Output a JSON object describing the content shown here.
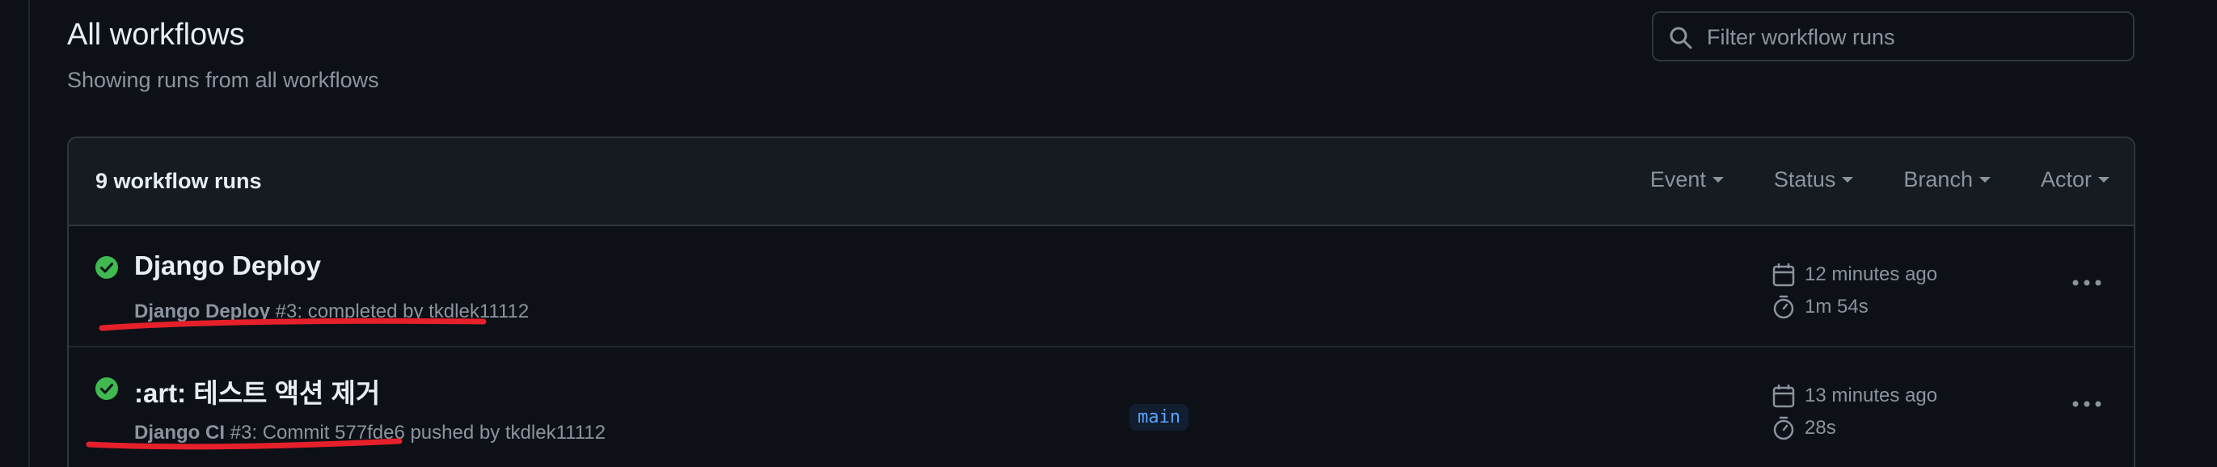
{
  "header": {
    "title": "All workflows",
    "subtitle": "Showing runs from all workflows"
  },
  "search": {
    "placeholder": "Filter workflow runs",
    "icon": "search-icon"
  },
  "runs_box": {
    "count_label": "9 workflow runs",
    "filters": [
      {
        "label": "Event"
      },
      {
        "label": "Status"
      },
      {
        "label": "Branch"
      },
      {
        "label": "Actor"
      }
    ]
  },
  "runs": [
    {
      "title": "Django Deploy",
      "workflow": "Django Deploy",
      "detail": " #3: completed by tkdlek11112",
      "branch": "",
      "started": "12 minutes ago",
      "duration": "1m 54s",
      "status": "success"
    },
    {
      "title": ":art: 테스트 액션 제거",
      "workflow": "Django CI",
      "detail": " #3: Commit 577fde6 pushed by tkdlek11112",
      "branch": "main",
      "started": "13 minutes ago",
      "duration": "28s",
      "status": "success"
    }
  ],
  "colors": {
    "background": "#0d1117",
    "header_bg": "#161b22",
    "border": "#30363d",
    "success": "#3fb950",
    "annotation": "#e5202a",
    "link": "#58a6ff"
  }
}
